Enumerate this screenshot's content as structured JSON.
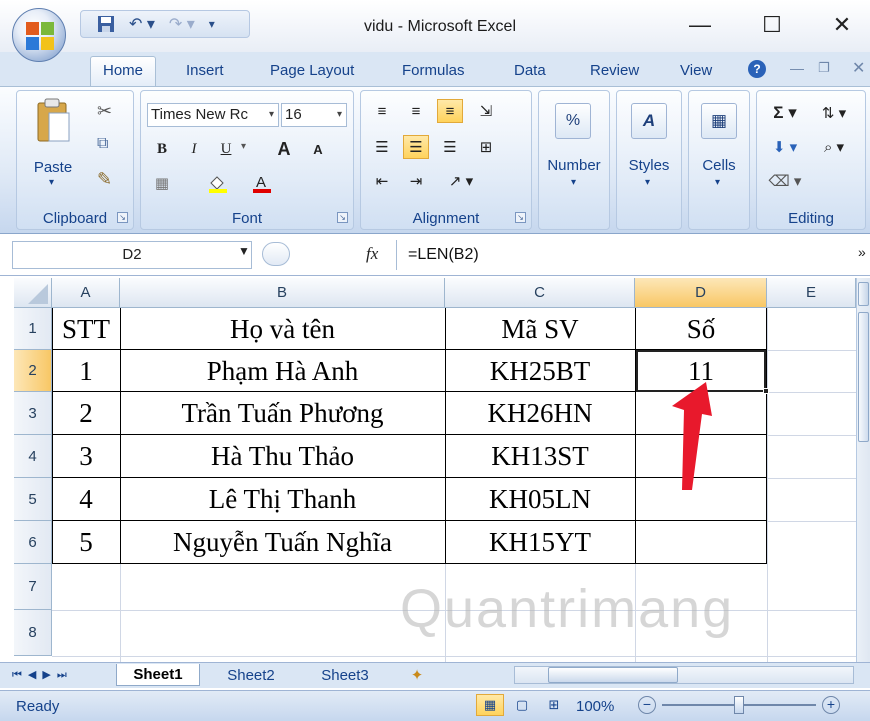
{
  "window": {
    "title": "vidu - Microsoft Excel"
  },
  "tabs": [
    "Home",
    "Insert",
    "Page Layout",
    "Formulas",
    "Data",
    "Review",
    "View"
  ],
  "ribbon": {
    "clipboard": {
      "label": "Clipboard",
      "paste": "Paste"
    },
    "font": {
      "label": "Font",
      "name": "Times New Rc",
      "size": "16"
    },
    "alignment": {
      "label": "Alignment"
    },
    "number": {
      "label": "Number",
      "symbol": "%"
    },
    "styles": {
      "label": "Styles"
    },
    "cells": {
      "label": "Cells"
    },
    "editing": {
      "label": "Editing"
    }
  },
  "formula_bar": {
    "name_box": "D2",
    "fx": "fx",
    "formula": "=LEN(B2)"
  },
  "columns": [
    "A",
    "B",
    "C",
    "D",
    "E"
  ],
  "rows": [
    "1",
    "2",
    "3",
    "4",
    "5",
    "6",
    "7",
    "8"
  ],
  "table": {
    "header": [
      "STT",
      "Họ và tên",
      "Mã SV",
      "Số"
    ],
    "rows": [
      [
        "1",
        "Phạm Hà Anh",
        "KH25BT",
        "11"
      ],
      [
        "2",
        "Trần Tuấn Phương",
        "KH26HN",
        ""
      ],
      [
        "3",
        "Hà Thu Thảo",
        "KH13ST",
        ""
      ],
      [
        "4",
        "Lê Thị Thanh",
        "KH05LN",
        ""
      ],
      [
        "5",
        "Nguyễn Tuấn Nghĩa",
        "KH15YT",
        ""
      ]
    ]
  },
  "sheets": [
    "Sheet1",
    "Sheet2",
    "Sheet3"
  ],
  "active_sheet": "Sheet1",
  "status": {
    "text": "Ready",
    "zoom": "100%"
  },
  "watermark": "Quantrimang",
  "colors": {
    "accent": "#15428b",
    "selection": "#f8c765",
    "arrow": "#e8192c"
  }
}
